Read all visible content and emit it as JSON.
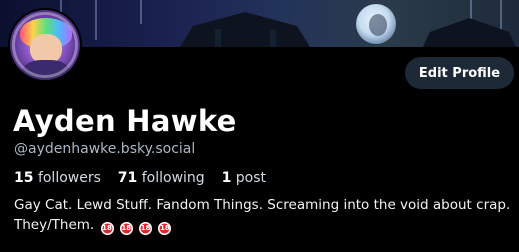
{
  "profile": {
    "display_name": "Ayden Hawke",
    "handle": "@aydenhawke.bsky.social",
    "edit_profile_label": "Edit Profile",
    "stats": {
      "followers_count": "15",
      "followers_label": "followers",
      "following_count": "71",
      "following_label": "following",
      "posts_count": "1",
      "posts_label": "post"
    },
    "bio_text": "Gay Cat. Lewd Stuff. Fandom Things. Screaming into the void about crap. They/Them.",
    "bio_badges": [
      "18",
      "18",
      "18",
      "18"
    ],
    "badge_icon": "adults-only-18-icon"
  },
  "colors": {
    "background": "#000000",
    "button_bg": "#1e2937",
    "handle_text": "#aab8c5",
    "badge_red": "#e0262b"
  }
}
